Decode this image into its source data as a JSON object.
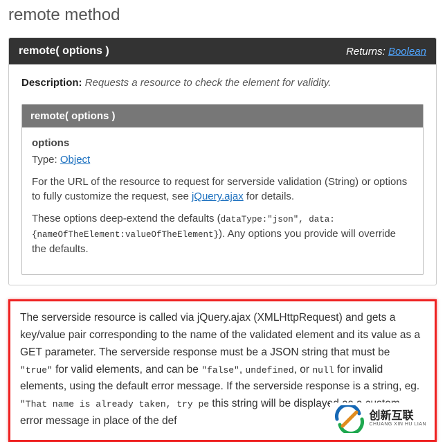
{
  "page": {
    "title": "remote method"
  },
  "panel": {
    "signature": "remote( options )",
    "returns_label": "Returns:",
    "returns_type": "Boolean",
    "description_label": "Description:",
    "description_text": "Requests a resource to check the element for validity."
  },
  "subpanel": {
    "signature": "remote( options )",
    "option_name": "options",
    "type_label": "Type:",
    "type_link": "Object",
    "para1_pre": "For the URL of the resource to request for serverside validation (String) or options to fully customize the request, see ",
    "para1_link": "jQuery.ajax",
    "para1_post": " for details.",
    "para2_pre": "These options deep-extend the defaults (",
    "para2_code": "dataType:\"json\", data:{nameOfTheElement:valueOfTheElement}",
    "para2_post": "). Any options you provide will override the defaults."
  },
  "highlight": {
    "t1": "The serverside resource is called via jQuery.ajax (XMLHttpRequest) and gets a key/value pair corresponding to the name of the validated element and its value as a GET parameter. The serverside response must be a JSON string that must be ",
    "c1": "\"true\"",
    "t2": " for valid elements, and can be ",
    "c2": "\"false\"",
    "t3": ", ",
    "c3": "undefined",
    "t4": ", or ",
    "c4": "null",
    "t5": " for invalid elements, using the default error message. If the serverside response is a string, eg. ",
    "c5": "\"That name is already taken, try pe",
    "t6": " this string will be displayed as a custom error message in place of the def"
  },
  "logo": {
    "cn": "创新互联",
    "en": "CHUANG XIN HU LIAN"
  }
}
